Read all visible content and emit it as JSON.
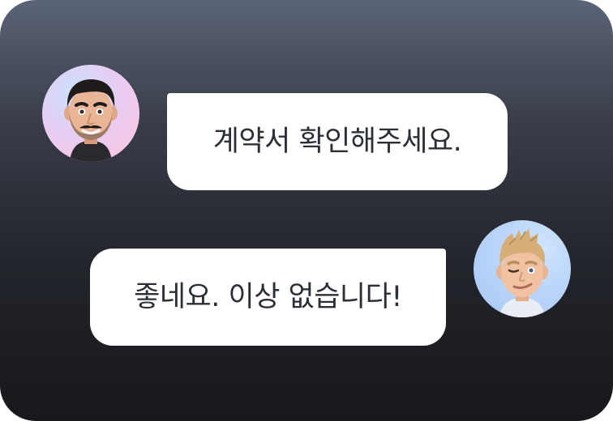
{
  "conversation": {
    "messages": [
      {
        "sender": "left",
        "text": "계약서 확인해주세요."
      },
      {
        "sender": "right",
        "text": "좋네요. 이상 없습니다!"
      }
    ]
  },
  "icons": {
    "avatar_left": "memoji-man-mustache-icon",
    "avatar_right": "memoji-man-winking-icon"
  },
  "colors": {
    "bubble": "#ffffff",
    "text": "#2b2f36",
    "background_top": "#5b6478",
    "background_bottom": "#17181c"
  }
}
